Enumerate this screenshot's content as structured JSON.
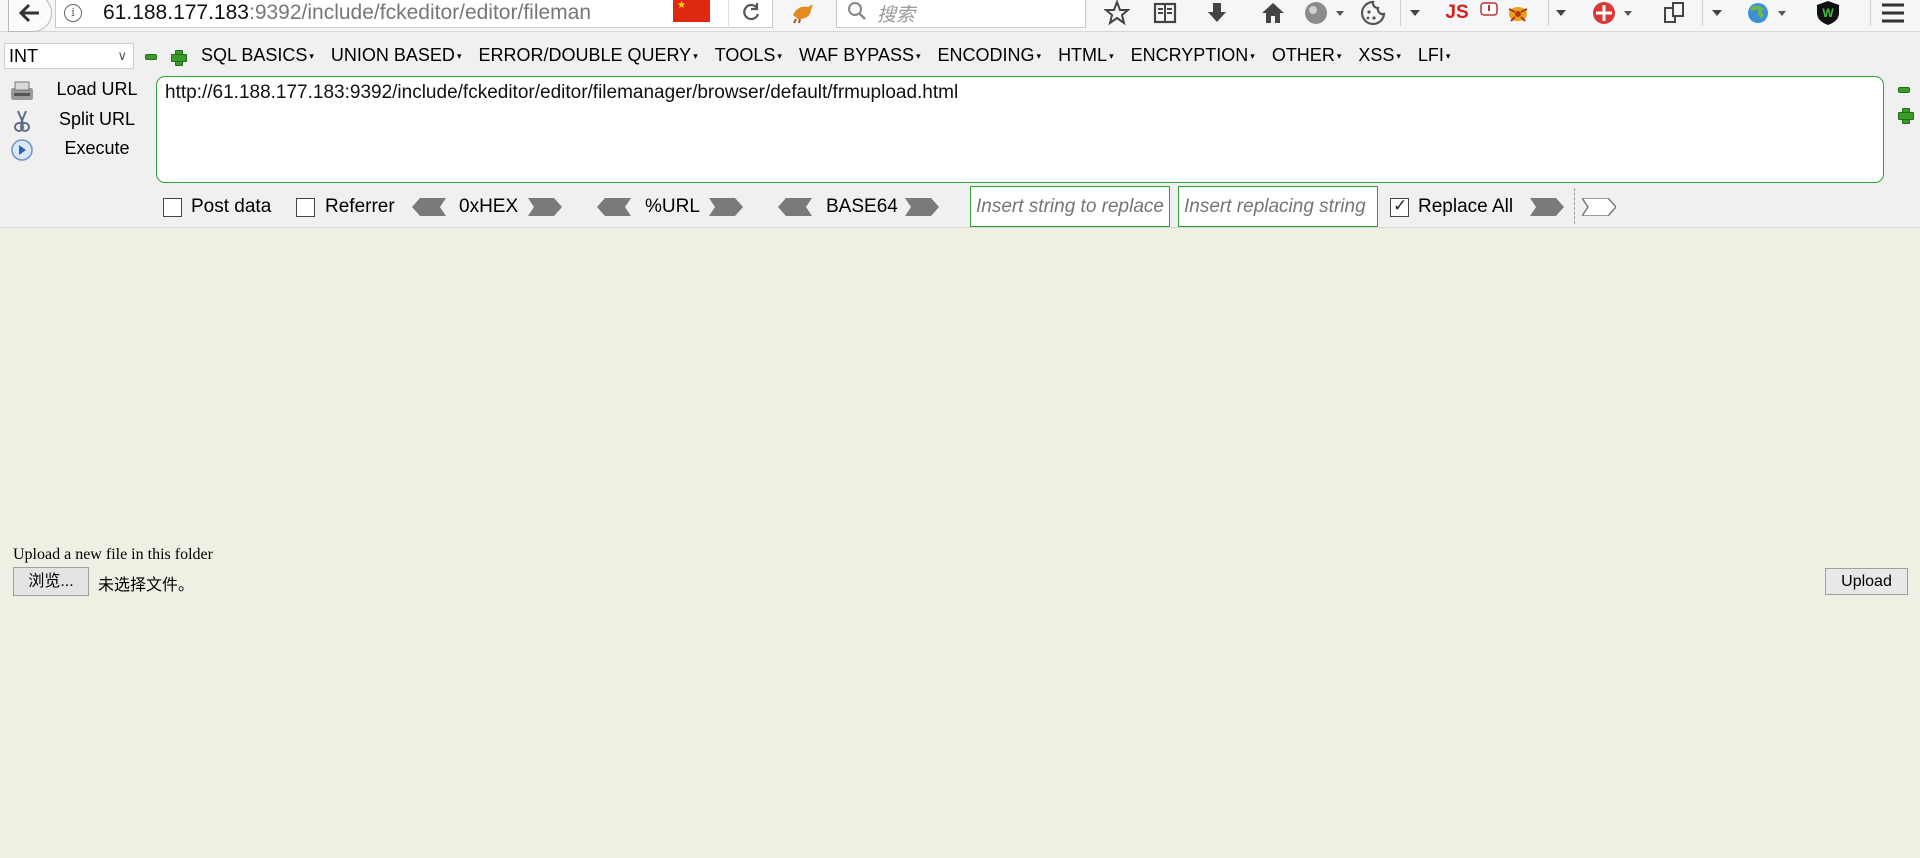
{
  "browser": {
    "url_host": "61.188.177.183",
    "url_rest": ":9392/include/fckeditor/editor/fileman",
    "search_placeholder": "搜索",
    "extension_js_label": "JS",
    "extension_w_label": "W"
  },
  "hackbar": {
    "injection_type": "INT",
    "menu": [
      {
        "label": "SQL BASICS"
      },
      {
        "label": "UNION BASED"
      },
      {
        "label": "ERROR/DOUBLE QUERY"
      },
      {
        "label": "TOOLS"
      },
      {
        "label": "WAF BYPASS"
      },
      {
        "label": "ENCODING"
      },
      {
        "label": "HTML"
      },
      {
        "label": "ENCRYPTION"
      },
      {
        "label": "OTHER"
      },
      {
        "label": "XSS"
      },
      {
        "label": "LFI"
      }
    ],
    "load_url": "Load URL",
    "split_url": "Split URL",
    "execute": "Execute",
    "url_value": "http://61.188.177.183:9392/include/fckeditor/editor/filemanager/browser/default/frmupload.html",
    "post_data": "Post data",
    "referrer": "Referrer",
    "hex": "0xHEX",
    "url_enc": "%URL",
    "base64": "BASE64",
    "replace_find_placeholder": "Insert string to replace",
    "replace_with_placeholder": "Insert replacing string",
    "replace_all": "Replace All",
    "post_checked": false,
    "referrer_checked": false,
    "replace_all_checked": true
  },
  "page": {
    "caption": "Upload a new file in this folder",
    "browse_label": "浏览...",
    "no_file": "未选择文件。",
    "upload_label": "Upload"
  },
  "colors": {
    "page_bg": "#efefe3",
    "hackbar_accent": "#2f9f2f",
    "flag_red": "#de2910"
  }
}
